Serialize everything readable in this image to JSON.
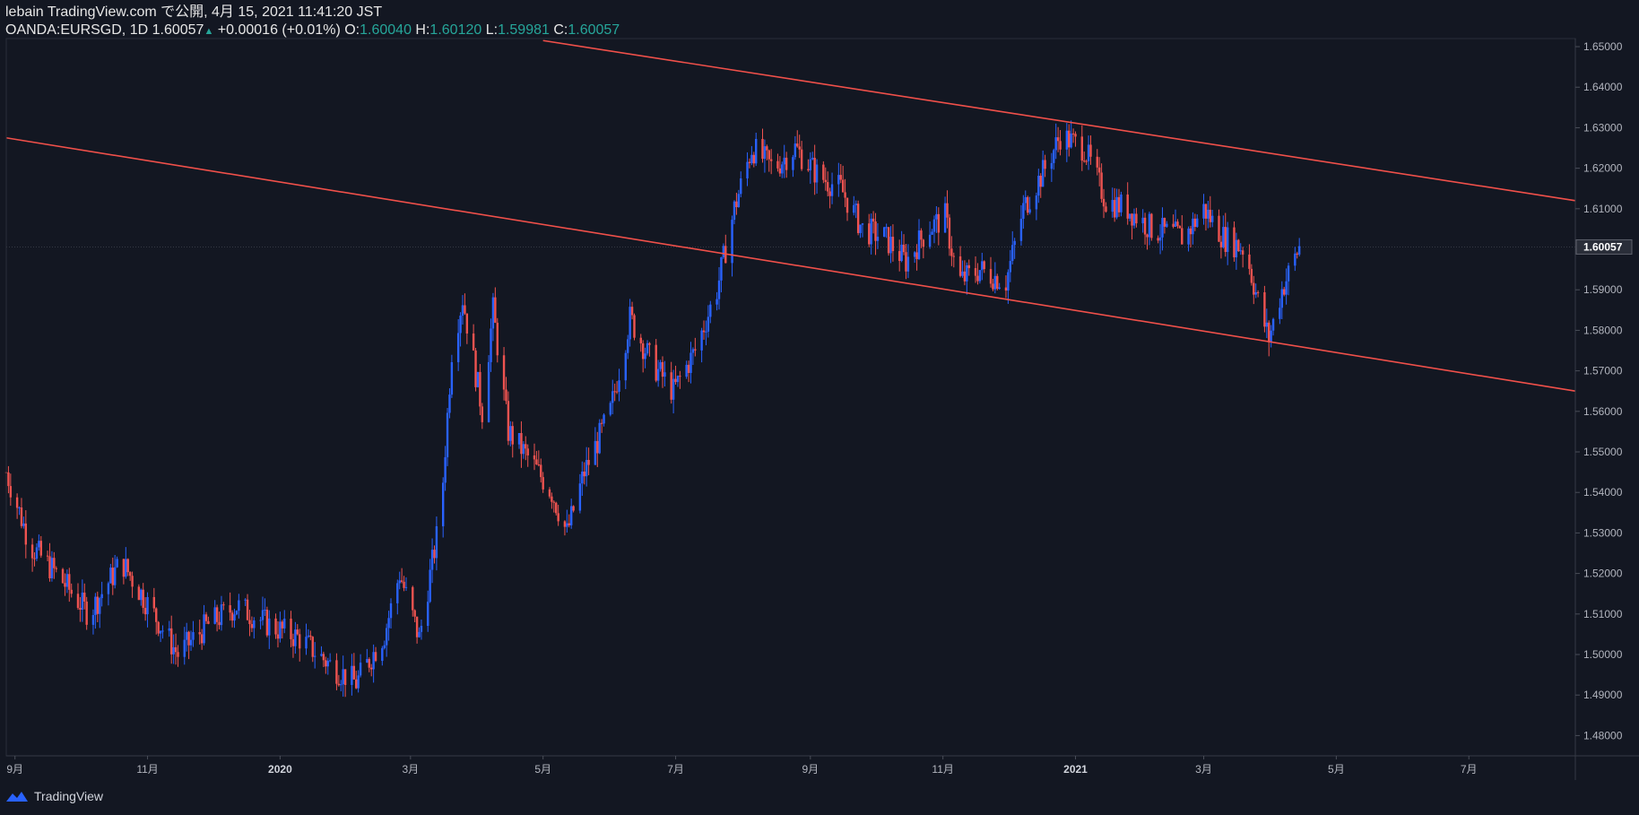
{
  "header": {
    "publisher": "lebain TradingView.com で公開, 4月 15, 2021 11:41:20 JST",
    "symbol": "OANDA:EURSGD, 1D",
    "last": "1.60057",
    "change": "+0.00016 (+0.01%)",
    "o_label": "O:",
    "o_value": "1.60040",
    "h_label": "H:",
    "h_value": "1.60120",
    "l_label": "L:",
    "l_value": "1.59981",
    "c_label": "C:",
    "c_value": "1.60057"
  },
  "footer": {
    "brand": "TradingView"
  },
  "colors": {
    "background": "#131722",
    "up": "#2962ff",
    "down": "#ef5350",
    "trendline": "#f0504a",
    "text": "#b2b5be"
  },
  "chart_data": {
    "type": "candlestick",
    "symbol": "OANDA:EURSGD",
    "interval": "1D",
    "ylim": [
      1.475,
      1.652
    ],
    "y_ticks": [
      "1.65000",
      "1.64000",
      "1.63000",
      "1.62000",
      "1.61000",
      "1.60000",
      "1.59000",
      "1.58000",
      "1.57000",
      "1.56000",
      "1.55000",
      "1.54000",
      "1.53000",
      "1.52000",
      "1.51000",
      "1.50000",
      "1.49000",
      "1.48000"
    ],
    "current_price": "1.60057",
    "x_ticks": [
      {
        "label": "9月",
        "date": "2019-09-01"
      },
      {
        "label": "11月",
        "date": "2019-11-01"
      },
      {
        "label": "2020",
        "date": "2020-01-01",
        "bold": true
      },
      {
        "label": "3月",
        "date": "2020-03-01"
      },
      {
        "label": "5月",
        "date": "2020-05-01"
      },
      {
        "label": "7月",
        "date": "2020-07-01"
      },
      {
        "label": "9月",
        "date": "2020-09-01"
      },
      {
        "label": "11月",
        "date": "2020-11-01"
      },
      {
        "label": "2021",
        "date": "2021-01-01",
        "bold": true
      },
      {
        "label": "3月",
        "date": "2021-03-01"
      },
      {
        "label": "5月",
        "date": "2021-05-01"
      },
      {
        "label": "7月",
        "date": "2021-07-01"
      }
    ],
    "x_range": [
      "2019-08-28",
      "2021-08-19"
    ],
    "close_path": [
      [
        "2019-08-28",
        1.545
      ],
      [
        "2019-09-08",
        1.527
      ],
      [
        "2019-09-20",
        1.52
      ],
      [
        "2019-10-05",
        1.51
      ],
      [
        "2019-10-20",
        1.523
      ],
      [
        "2019-11-05",
        1.509
      ],
      [
        "2019-11-15",
        1.5
      ],
      [
        "2019-11-28",
        1.507
      ],
      [
        "2019-12-12",
        1.512
      ],
      [
        "2019-12-28",
        1.507
      ],
      [
        "2020-01-10",
        1.504
      ],
      [
        "2020-01-25",
        1.497
      ],
      [
        "2020-02-05",
        1.493
      ],
      [
        "2020-02-18",
        1.505
      ],
      [
        "2020-02-25",
        1.52
      ],
      [
        "2020-03-05",
        1.504
      ],
      [
        "2020-03-15",
        1.535
      ],
      [
        "2020-03-20",
        1.575
      ],
      [
        "2020-03-25",
        1.588
      ],
      [
        "2020-04-03",
        1.56
      ],
      [
        "2020-04-08",
        1.585
      ],
      [
        "2020-04-15",
        1.555
      ],
      [
        "2020-04-25",
        1.548
      ],
      [
        "2020-05-05",
        1.54
      ],
      [
        "2020-05-12",
        1.53
      ],
      [
        "2020-05-20",
        1.545
      ],
      [
        "2020-06-01",
        1.56
      ],
      [
        "2020-06-10",
        1.583
      ],
      [
        "2020-06-20",
        1.572
      ],
      [
        "2020-06-30",
        1.565
      ],
      [
        "2020-07-10",
        1.575
      ],
      [
        "2020-07-20",
        1.59
      ],
      [
        "2020-07-28",
        1.61
      ],
      [
        "2020-08-05",
        1.625
      ],
      [
        "2020-08-15",
        1.62
      ],
      [
        "2020-08-25",
        1.625
      ],
      [
        "2020-09-05",
        1.618
      ],
      [
        "2020-09-15",
        1.615
      ],
      [
        "2020-09-25",
        1.605
      ],
      [
        "2020-10-05",
        1.603
      ],
      [
        "2020-10-15",
        1.597
      ],
      [
        "2020-10-25",
        1.605
      ],
      [
        "2020-11-02",
        1.608
      ],
      [
        "2020-11-08",
        1.592
      ],
      [
        "2020-11-18",
        1.595
      ],
      [
        "2020-11-30",
        1.592
      ],
      [
        "2020-12-08",
        1.61
      ],
      [
        "2020-12-18",
        1.62
      ],
      [
        "2020-12-25",
        1.628
      ],
      [
        "2021-01-05",
        1.625
      ],
      [
        "2021-01-15",
        1.612
      ],
      [
        "2021-01-25",
        1.61
      ],
      [
        "2021-02-05",
        1.605
      ],
      [
        "2021-02-20",
        1.603
      ],
      [
        "2021-03-01",
        1.61
      ],
      [
        "2021-03-10",
        1.603
      ],
      [
        "2021-03-20",
        1.6
      ],
      [
        "2021-03-28",
        1.583
      ],
      [
        "2021-03-31",
        1.578
      ],
      [
        "2021-04-06",
        1.59
      ],
      [
        "2021-04-14",
        1.6006
      ]
    ],
    "trendlines": [
      {
        "name": "lower",
        "from": [
          "2019-08-28",
          1.6275
        ],
        "to": [
          "2021-08-19",
          1.565
        ]
      },
      {
        "name": "upper",
        "from": [
          "2020-05-01",
          1.6515
        ],
        "to": [
          "2021-08-19",
          1.612
        ]
      }
    ]
  }
}
